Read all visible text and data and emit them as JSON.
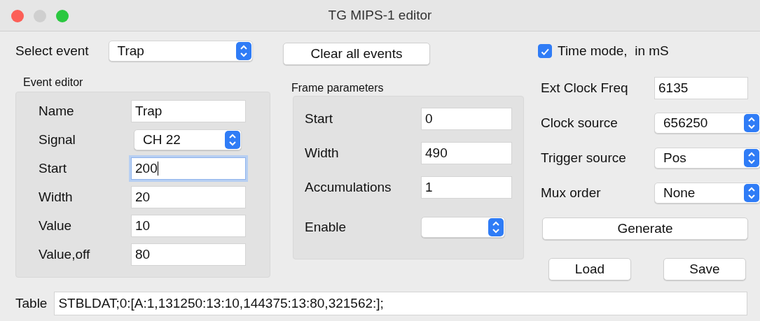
{
  "window": {
    "title": "TG MIPS-1 editor"
  },
  "select_event": {
    "label": "Select event",
    "value": "Trap"
  },
  "clear_button": "Clear all events",
  "time_mode": {
    "label": "Time mode,  in mS",
    "checked": true
  },
  "event_editor": {
    "title": "Event editor",
    "fields": [
      {
        "kind": "text",
        "label": "Name",
        "value": "Trap",
        "focused": false
      },
      {
        "kind": "select",
        "label": "Signal",
        "value": "CH 22"
      },
      {
        "kind": "text",
        "label": "Start",
        "value": "200",
        "focused": true
      },
      {
        "kind": "text",
        "label": "Width",
        "value": "20",
        "focused": false
      },
      {
        "kind": "text",
        "label": "Value",
        "value": "10",
        "focused": false
      },
      {
        "kind": "text",
        "label": "Value,off",
        "value": "80",
        "focused": false
      }
    ]
  },
  "frame_parameters": {
    "title": "Frame parameters",
    "fields": [
      {
        "kind": "text",
        "label": "Start",
        "value": "0",
        "focused": false
      },
      {
        "kind": "text",
        "label": "Width",
        "value": "490",
        "focused": false
      },
      {
        "kind": "text",
        "label": "Accumulations",
        "value": "1",
        "focused": false
      },
      {
        "kind": "select",
        "label": "Enable"
      }
    ]
  },
  "clock_settings": [
    {
      "kind": "text",
      "label": "Ext Clock Freq",
      "value": "6135",
      "focused": false
    },
    {
      "kind": "select",
      "label": "Clock source",
      "value": "656250"
    },
    {
      "kind": "select",
      "label": "Trigger source",
      "value": "Pos"
    },
    {
      "kind": "select",
      "label": "Mux order",
      "value": "None"
    }
  ],
  "generate_button": "Generate",
  "load_button": "Load",
  "save_button": "Save",
  "table": {
    "label": "Table",
    "value": "STBLDAT;0:[A:1,131250:13:10,144375:13:80,321562:];"
  }
}
